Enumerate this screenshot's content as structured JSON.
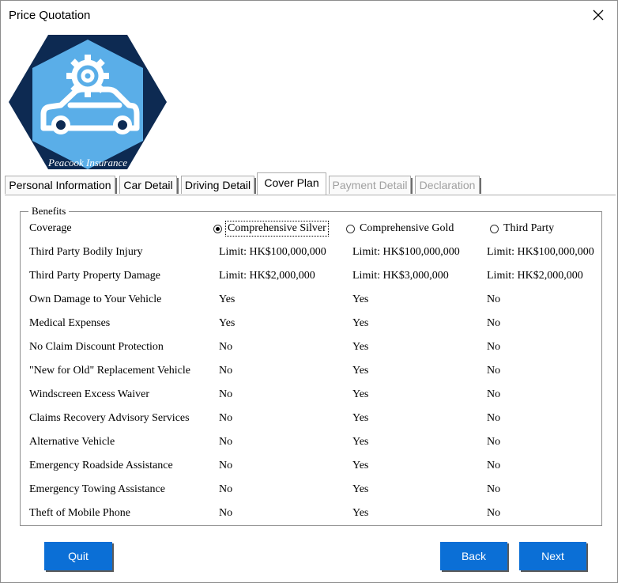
{
  "window": {
    "title": "Price Quotation"
  },
  "logo": {
    "brand_text": "Peacook Insurance"
  },
  "tabs": [
    {
      "label": "Personal Information",
      "state": "normal"
    },
    {
      "label": "Car Detail",
      "state": "normal"
    },
    {
      "label": "Driving Detail",
      "state": "normal"
    },
    {
      "label": "Cover Plan",
      "state": "active"
    },
    {
      "label": "Payment Detail",
      "state": "disabled"
    },
    {
      "label": "Declaration",
      "state": "disabled"
    }
  ],
  "benefits": {
    "group_title": "Benefits",
    "coverage_label": "Coverage",
    "plans": [
      {
        "label": "Comprehensive Silver",
        "selected": true
      },
      {
        "label": "Comprehensive Gold",
        "selected": false
      },
      {
        "label": "Third Party",
        "selected": false
      }
    ],
    "rows": [
      {
        "label": "Third Party Bodily Injury",
        "values": [
          "Limit: HK$100,000,000",
          "Limit: HK$100,000,000",
          "Limit: HK$100,000,000"
        ]
      },
      {
        "label": "Third Party Property Damage",
        "values": [
          "Limit: HK$2,000,000",
          "Limit: HK$3,000,000",
          "Limit: HK$2,000,000"
        ]
      },
      {
        "label": "Own Damage to Your Vehicle",
        "values": [
          "Yes",
          "Yes",
          "No"
        ]
      },
      {
        "label": "Medical Expenses",
        "values": [
          "Yes",
          "Yes",
          "No"
        ]
      },
      {
        "label": "No Claim Discount Protection",
        "values": [
          "No",
          "Yes",
          "No"
        ]
      },
      {
        "label": "\"New for Old\" Replacement Vehicle",
        "values": [
          "No",
          "Yes",
          "No"
        ]
      },
      {
        "label": "Windscreen Excess Waiver",
        "values": [
          "No",
          "Yes",
          "No"
        ]
      },
      {
        "label": "Claims Recovery Advisory Services",
        "values": [
          "No",
          "Yes",
          "No"
        ]
      },
      {
        "label": "Alternative Vehicle",
        "values": [
          "No",
          "Yes",
          "No"
        ]
      },
      {
        "label": "Emergency Roadside Assistance",
        "values": [
          "No",
          "Yes",
          "No"
        ]
      },
      {
        "label": "Emergency Towing Assistance",
        "values": [
          "No",
          "Yes",
          "No"
        ]
      },
      {
        "label": "Theft of Mobile Phone",
        "values": [
          "No",
          "Yes",
          "No"
        ]
      }
    ]
  },
  "buttons": {
    "quit": "Quit",
    "back": "Back",
    "next": "Next"
  },
  "colors": {
    "button": "#0b6fd6",
    "logo_dark": "#0d2a52",
    "logo_light": "#5aaee8"
  }
}
